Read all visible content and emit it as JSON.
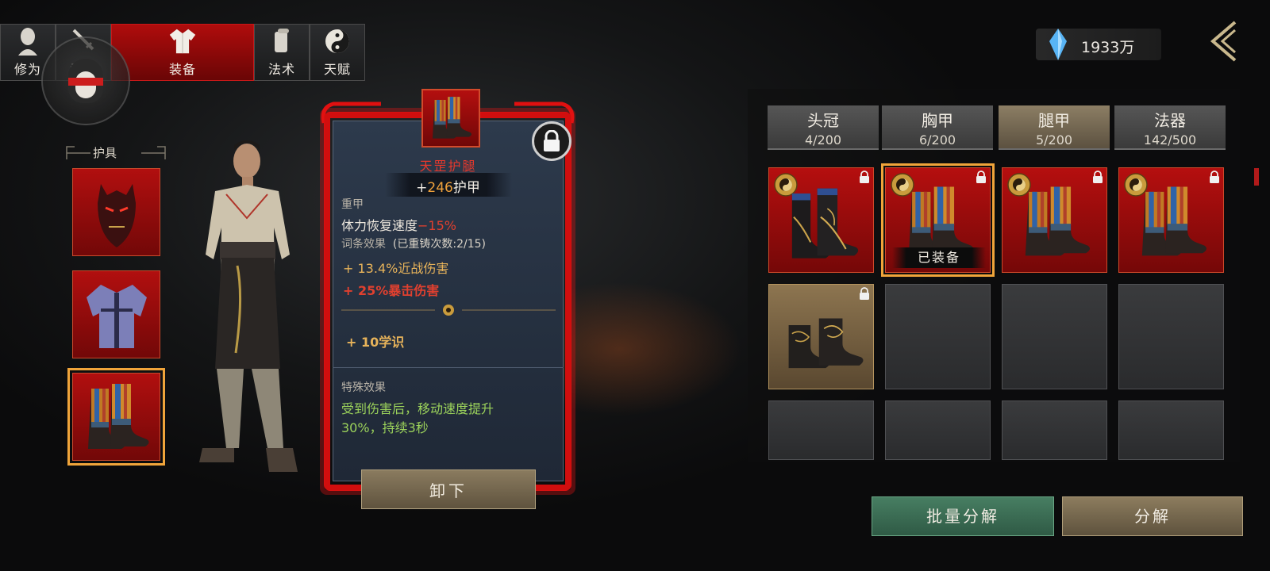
{
  "nav": {
    "tabs": [
      {
        "label": "修为",
        "icon": "monk-head-icon"
      },
      {
        "label": "武器",
        "icon": "sword-icon"
      },
      {
        "label": "装备",
        "icon": "robe-icon"
      },
      {
        "label": "法术",
        "icon": "scroll-icon"
      },
      {
        "label": "天赋",
        "icon": "taiji-icon"
      }
    ],
    "active_tab": "装备"
  },
  "currency": {
    "value": "1933万",
    "icon": "blue-crystal-icon"
  },
  "equipment_slots": {
    "title": "护具",
    "slots": [
      {
        "name": "mask",
        "icon": "demon-mask-icon"
      },
      {
        "name": "chest",
        "icon": "robe-armor-icon"
      },
      {
        "name": "legs",
        "icon": "boots-icon",
        "selected": true
      }
    ]
  },
  "item_detail": {
    "name": "天罡护腿",
    "armor_prefix": "+",
    "armor_value": "246",
    "armor_label": "护甲",
    "type": "重甲",
    "base_stat_label": "体力恢复速度",
    "base_stat_value": "−15%",
    "affix_header": "词条效果",
    "reforge_info": "(已重铸次数:2/15)",
    "affixes": [
      {
        "text": "+ 13.4%近战伤害",
        "color": "#e7b35a"
      },
      {
        "text": "+ 25%暴击伤害",
        "color": "#e0402f"
      }
    ],
    "bonus": "+ 10学识",
    "special_header": "特殊效果",
    "special_text_1": "受到伤害后，移动速度提升",
    "special_text_2": "30%，持续3秒",
    "unequip_label": "卸下",
    "locked": true
  },
  "inventory": {
    "categories": [
      {
        "name": "头冠",
        "count": "4/200"
      },
      {
        "name": "胸甲",
        "count": "6/200"
      },
      {
        "name": "腿甲",
        "count": "5/200",
        "active": true
      },
      {
        "name": "法器",
        "count": "142/500"
      }
    ],
    "equipped_label": "已装备",
    "items": [
      {
        "style": "red",
        "variant": "black-gold-boots",
        "emblem": true,
        "locked": true
      },
      {
        "style": "red",
        "variant": "striped-boots",
        "emblem": true,
        "locked": true,
        "equipped": true
      },
      {
        "style": "red",
        "variant": "striped-boots",
        "emblem": true,
        "locked": true
      },
      {
        "style": "red",
        "variant": "striped-boots",
        "emblem": true,
        "locked": true
      },
      {
        "style": "bronze",
        "variant": "embroidered-boots",
        "emblem": false,
        "locked": true
      }
    ]
  },
  "buttons": {
    "batch_decompose": "批量分解",
    "decompose": "分解"
  },
  "colors": {
    "rare_red": "#b50f0f",
    "highlight_gold": "#f0a43a",
    "green_button": "#477e62"
  }
}
